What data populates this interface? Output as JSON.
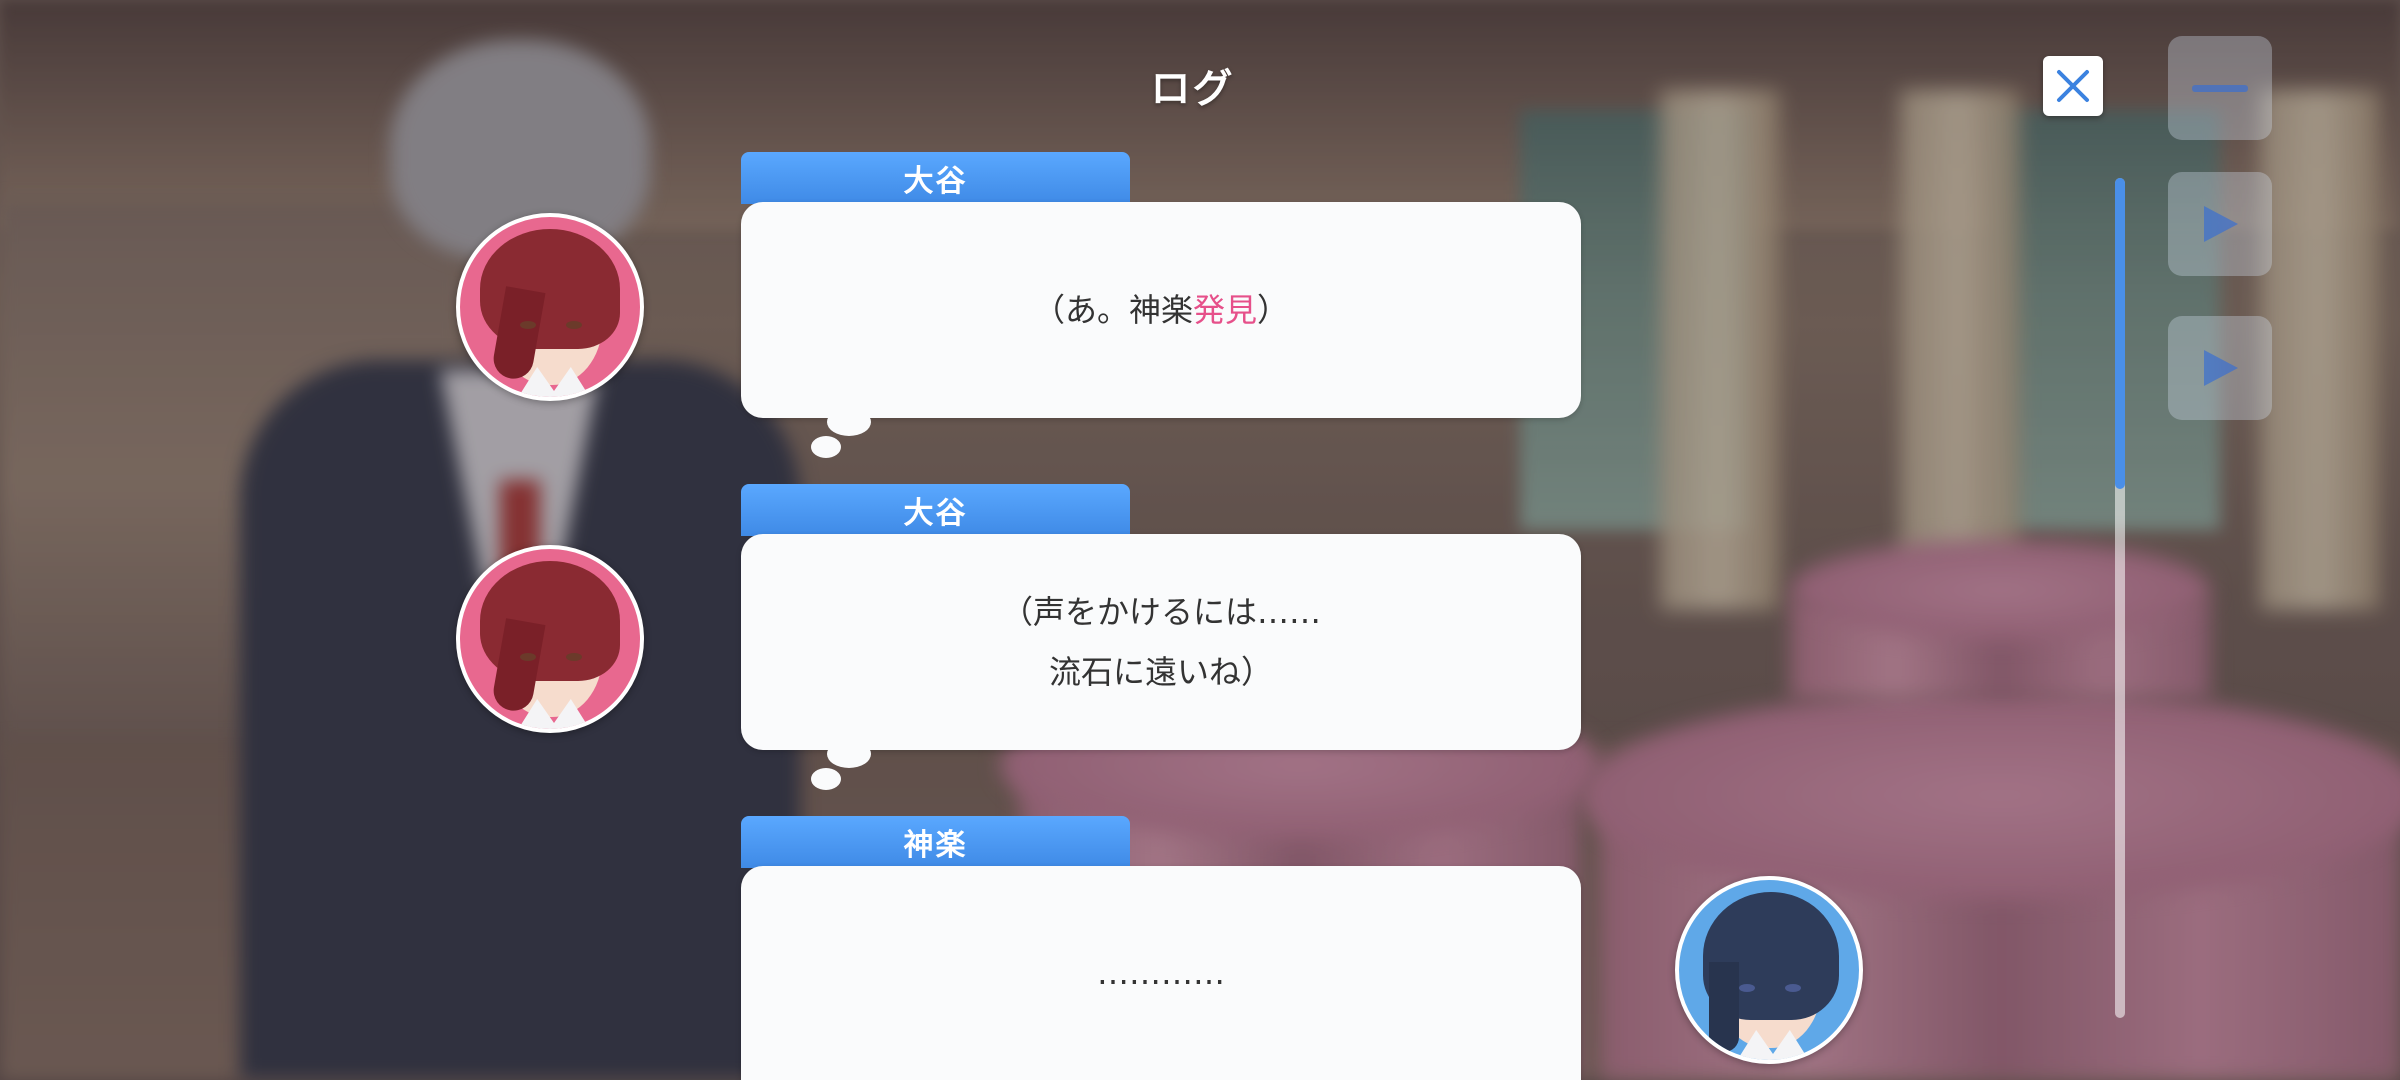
{
  "header": {
    "title": "ログ"
  },
  "entries": [
    {
      "speaker": "大谷",
      "avatar": "otani-portrait",
      "line_prefix": "（あ。神楽",
      "line_highlight": "発見",
      "line_suffix": "）"
    },
    {
      "speaker": "大谷",
      "avatar": "otani-portrait",
      "line1": "（声をかけるには……",
      "line2": "流石に遠いね）"
    },
    {
      "speaker": "神楽",
      "avatar": "kagura-portrait",
      "line1": "…………"
    }
  ],
  "colors": {
    "name_tab": "#4a97f0",
    "highlight_text": "#e6508a",
    "scroll_thumb": "#4a8fe8",
    "avatar_pink": "#e8688f",
    "avatar_blue": "#5fa8e8"
  },
  "icons": {
    "close": "close-icon",
    "side_controls": [
      "menu-icon",
      "play-icon",
      "skip-icon"
    ]
  },
  "scroll": {
    "position_fraction": 0.0,
    "visible_fraction": 0.37
  }
}
